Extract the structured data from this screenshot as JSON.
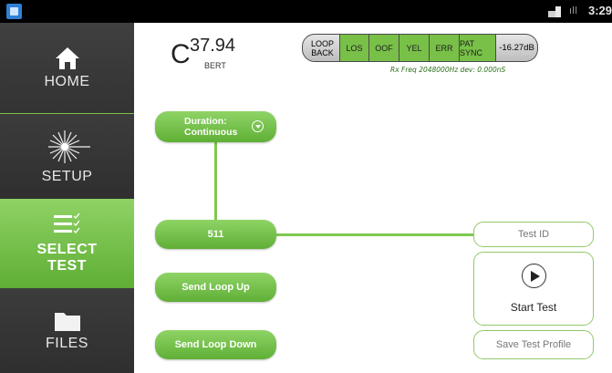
{
  "status_bar": {
    "time": "3:29",
    "app_icon": "app-icon",
    "signal_icon": "sim-signal-icon",
    "bars_icon": "cell-bars-icon"
  },
  "sidebar": {
    "items": [
      {
        "label": "HOME",
        "icon": "home-icon"
      },
      {
        "label": "SETUP",
        "icon": "laser-burst-icon"
      },
      {
        "label": "SELECT\nTEST",
        "icon": "checklist-icon",
        "selected": true
      },
      {
        "label": "FILES",
        "icon": "folder-icon"
      }
    ]
  },
  "header": {
    "temp_symbol": "C",
    "temp_value": "37.94",
    "temp_unit": "BERT"
  },
  "alarms": [
    {
      "label": "LOOP\nBACK",
      "state": "gray"
    },
    {
      "label": "LOS",
      "state": "green"
    },
    {
      "label": "OOF",
      "state": "green"
    },
    {
      "label": "YEL",
      "state": "green"
    },
    {
      "label": "ERR",
      "state": "green"
    },
    {
      "label": "PAT SYNC",
      "state": "green"
    },
    {
      "label": "-16.27dB",
      "state": "gray"
    }
  ],
  "rx_info": "Rx Freq 2048000Hz dev: 0.000nS",
  "controls": {
    "duration_label": "Duration:",
    "duration_value": "Continuous",
    "pattern": "511",
    "loop_up": "Send Loop Up",
    "loop_down": "Send Loop Down",
    "test_id": "Test ID",
    "start_test": "Start Test",
    "save_profile": "Save Test Profile"
  },
  "colors": {
    "accent_green": "#78c048",
    "sidebar_bg": "#3b3b3b",
    "panel_bg": "#ffffff"
  }
}
